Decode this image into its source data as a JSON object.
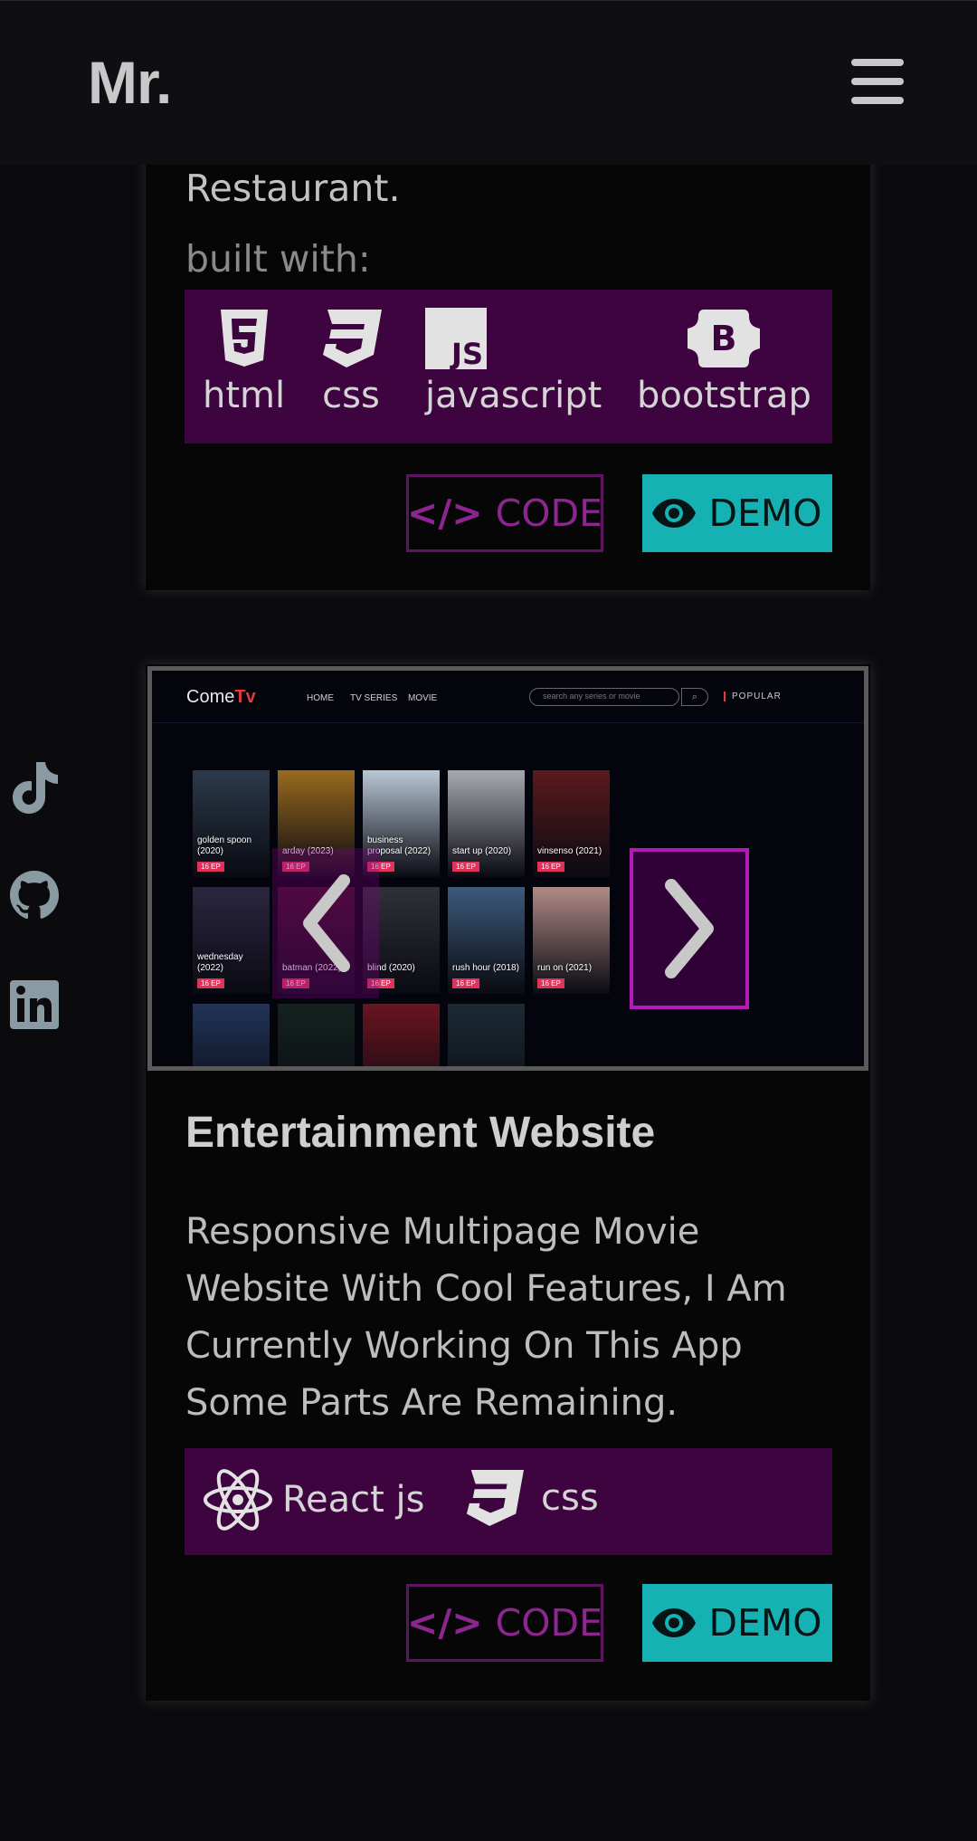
{
  "header": {
    "logo": "Mr."
  },
  "social": [
    {
      "name": "tiktok-icon"
    },
    {
      "name": "github-icon"
    },
    {
      "name": "linkedin-icon"
    }
  ],
  "project1": {
    "desc_tail": "Restaurant.",
    "built_label": "built with:",
    "tech": [
      {
        "label": "html",
        "icon": "html5-icon"
      },
      {
        "label": "css",
        "icon": "css3-icon"
      },
      {
        "label": "javascript",
        "icon": "js-icon"
      },
      {
        "label": "bootstrap",
        "icon": "bootstrap-icon"
      }
    ],
    "code_label": "CODE",
    "demo_label": "DEMO"
  },
  "project2": {
    "screenshot": {
      "logo_a": "Come",
      "logo_b": "Tv",
      "nav": [
        "HOME",
        "TV SERIES",
        "MOVIE"
      ],
      "search_placeholder": "search any series or movie",
      "popular": "POPULAR",
      "posters": [
        {
          "title": "golden spoon (2020)",
          "ep": "16 EP",
          "color": "#2b3a4a"
        },
        {
          "title": "arday (2023)",
          "ep": "16 EP",
          "color": "#9a6a1e"
        },
        {
          "title": "business proposal (2022)",
          "ep": "16 EP",
          "color": "#b9c7d6"
        },
        {
          "title": "start up (2020)",
          "ep": "16 EP",
          "color": "#a7a9b1"
        },
        {
          "title": "vinsenso (2021)",
          "ep": "16 EP",
          "color": "#5a1a1e"
        },
        {
          "title": "wednesday (2022)",
          "ep": "16 EP",
          "color": "#2a2640"
        },
        {
          "title": "batman (2022)",
          "ep": "16 EP",
          "color": "#3a1020"
        },
        {
          "title": "blind (2020)",
          "ep": "16 EP",
          "color": "#2f3136"
        },
        {
          "title": "rush hour (2018)",
          "ep": "16 EP",
          "color": "#3c5a7a"
        },
        {
          "title": "run on (2021)",
          "ep": "16 EP",
          "color": "#b08a86"
        },
        {
          "title": "",
          "ep": "",
          "color": "#203458"
        },
        {
          "title": "",
          "ep": "",
          "color": "#14221e"
        },
        {
          "title": "",
          "ep": "",
          "color": "#6a1420"
        },
        {
          "title": "",
          "ep": "",
          "color": "#1c2a34"
        }
      ]
    },
    "title": "Entertainment Website",
    "description": "Responsive Multipage Movie Website With Cool Features, I Am Currently Working On This App Some Parts Are Remaining.",
    "tech": [
      {
        "label": "React js",
        "icon": "react-icon"
      },
      {
        "label": "css",
        "icon": "css3-icon"
      }
    ],
    "code_label": "CODE",
    "demo_label": "DEMO"
  },
  "colors": {
    "background": "#0b0b0e",
    "tech_bar": "#3d0440",
    "code_border": "#5d1561",
    "demo_bg": "#16b2b3",
    "arrow_border": "#b21bb7"
  }
}
